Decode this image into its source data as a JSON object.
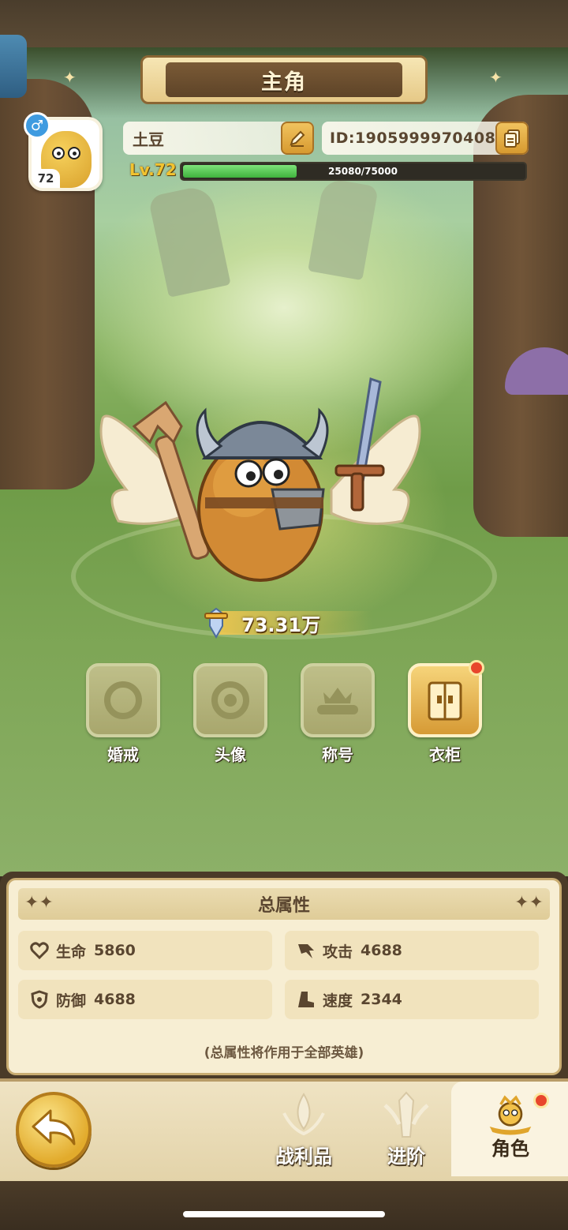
{
  "header": {
    "title": "主角"
  },
  "profile": {
    "name": "土豆",
    "id_text": "ID:1905999970408",
    "avatar_level": "72",
    "level_label": "Lv.72",
    "xp_text": "25080/75000",
    "xp_fraction": 0.3344
  },
  "power": {
    "value": "73.31万"
  },
  "features": [
    {
      "label": "婚戒",
      "icon": "ring-icon"
    },
    {
      "label": "头像",
      "icon": "avatar-frame-icon"
    },
    {
      "label": "称号",
      "icon": "title-badge-icon"
    },
    {
      "label": "衣柜",
      "icon": "wardrobe-icon"
    }
  ],
  "stats": {
    "title": "总属性",
    "items": [
      {
        "label": "生命",
        "value": "5860",
        "icon": "heart-icon"
      },
      {
        "label": "攻击",
        "value": "4688",
        "icon": "attack-icon"
      },
      {
        "label": "防御",
        "value": "4688",
        "icon": "shield-icon"
      },
      {
        "label": "速度",
        "value": "2344",
        "icon": "boot-icon"
      }
    ],
    "note": "(总属性将作用于全部英雄)"
  },
  "nav": {
    "items": [
      {
        "label": "战利品",
        "icon": "loot-icon"
      },
      {
        "label": "进阶",
        "icon": "advance-icon"
      },
      {
        "label": "角色",
        "icon": "character-icon"
      }
    ]
  },
  "colors": {
    "accent_gold": "#f2c330",
    "xp_green": "#3fb33c",
    "badge_red": "#e8462c",
    "panel_cream": "#f7eed3"
  }
}
